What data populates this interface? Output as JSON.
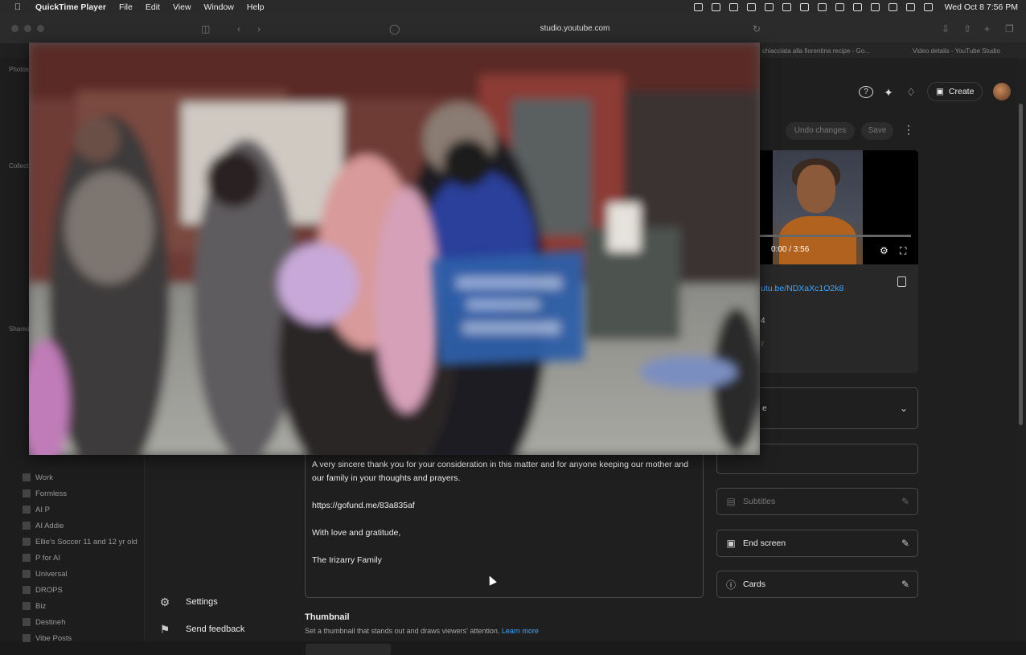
{
  "menubar": {
    "app_name": "QuickTime Player",
    "menus": [
      "File",
      "Edit",
      "View",
      "Window",
      "Help"
    ],
    "clock": "Wed Oct 8  7:56 PM"
  },
  "browser": {
    "url": "studio.youtube.com",
    "tabs": [
      "chiacciata alla fiorentina recipe - Go...",
      "Video details - YouTube Studio"
    ]
  },
  "photos_sidebar": {
    "section_photos": "Photos",
    "section_collections": "Collections",
    "section_shared": "Shared",
    "albums": [
      "Work",
      "Formless",
      "AI P",
      "AI Addie",
      "Ellie's Soccer 11 and 12 yr old",
      "P for AI",
      "Universal",
      "DROPS",
      "Biz",
      "Destineh",
      "Vibe Posts"
    ]
  },
  "studio": {
    "nav_bottom": [
      {
        "label": "Settings",
        "icon": "gear-icon"
      },
      {
        "label": "Send feedback",
        "icon": "feedback-icon"
      }
    ],
    "header": {
      "create_label": "Create",
      "undo_label": "Undo changes",
      "save_label": "Save"
    },
    "description_paragraphs": [
      "A very sincere thank you for your consideration in this matter and for anyone keeping our mother and our family in your thoughts and prayers.",
      "https://gofund.me/83a835af",
      "With love and gratitude,",
      "The Irizarry Family"
    ],
    "thumbnail": {
      "title": "Thumbnail",
      "subtitle": "Set a thumbnail that stands out and draws viewers' attention.",
      "learn_more": "Learn more"
    },
    "player": {
      "timecode": "0:00 / 3:56",
      "progress_fraction": 0.0
    },
    "video_link": "utu.be/NDXaXc1O2k8",
    "video_info_partial": [
      "4",
      "y"
    ],
    "dropdown_partial": "e",
    "cards": [
      {
        "label": "Subtitles",
        "icon": "subtitles-icon",
        "enabled": false
      },
      {
        "label": "End screen",
        "icon": "end-screen-icon",
        "enabled": true
      },
      {
        "label": "Cards",
        "icon": "info-icon",
        "enabled": true
      }
    ]
  },
  "colors": {
    "link_blue": "#3ea6ff",
    "studio_bg": "#1f1f1f",
    "sign_blue": "#2d5fa8"
  }
}
